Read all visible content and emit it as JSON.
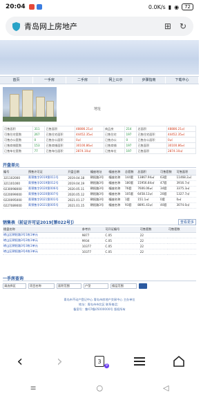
{
  "status_bar": {
    "time": "20:04",
    "network": "0.0K/s",
    "battery": "72",
    "signal_icon": "cellular-signal-icon",
    "wifi_icon": "wifi-icon"
  },
  "address_bar": {
    "page_title": "青岛网上房地产",
    "shield_icon": "shield-icon",
    "bookmark_icon": "bookmark-icon",
    "refresh_icon": "refresh-icon"
  },
  "nav": {
    "items": [
      "首页",
      "一手房",
      "二手房",
      "网上公示",
      "步骤指南",
      "下载中心"
    ]
  },
  "hero": {
    "caption": "地址"
  },
  "stats": {
    "rows": [
      [
        "可售面积",
        "311",
        "已售面积",
        "48886.21㎡",
        "商品房",
        "214",
        "总面积",
        "48886.21㎡"
      ],
      [
        "可售住宅套数",
        "267",
        "已售住宅面积",
        "44452.35㎡",
        "已售住宅",
        "197",
        "已售住宅面积",
        "44452.35㎡"
      ],
      [
        "可售办公套数",
        "0",
        "已售办公面积",
        "0㎡",
        "已售办公",
        "0",
        "已售办公面积",
        "0㎡"
      ],
      [
        "已售商铺套数",
        "153",
        "已售商铺面积",
        "30100.86㎡",
        "已售商铺",
        "197",
        "已售面积",
        "30100.86㎡"
      ],
      [
        "已售车位套数",
        "77",
        "已售车位面积",
        "2874.10㎡",
        "已售车位",
        "197",
        "已售面积",
        "2874.10㎡"
      ]
    ]
  },
  "units_section": {
    "title": "开盘单元",
    "headers": [
      "编号",
      "预售许可证",
      "开盘日期",
      "幢座地址",
      "幢座名称",
      "总套数",
      "总面积",
      "可售套数",
      "可售面积"
    ],
    "rows": [
      [
        "321102000",
        "青预售字2019第011号",
        "2019.04.18",
        "朝阳路3号",
        "幢座名称",
        "144套",
        "13867.94㎡",
        "63套",
        "11468.2㎡"
      ],
      [
        "321101000",
        "青预售字2019第012号",
        "2019.04.19",
        "朝阳路3号",
        "幢座名称",
        "180套",
        "15956.84㎡",
        "47套",
        "3916.7㎡"
      ],
      [
        "0230098000",
        "青预售字2020第006号",
        "2020.05.11",
        "朝阳路3号",
        "幢座名称",
        "76套",
        "7606.06㎡",
        "34套",
        "3375.3㎡"
      ],
      [
        "0220099000",
        "青预售字2020第007号",
        "2020.05.12",
        "朝阳路3号",
        "幢座名称",
        "105套",
        "6458.13㎡",
        "20套",
        "1327.7㎡"
      ],
      [
        "0220095000",
        "青预售字2021第001号",
        "2021.01.17",
        "朝阳路3号",
        "幢座名称",
        "1套",
        "151.1㎡",
        "0套",
        "0㎡"
      ],
      [
        "0227089000",
        "青预售字2021第005号",
        "2021.01.15",
        "朝阳路3号",
        "幢座名称",
        "93套",
        "8891.43㎡",
        "40套",
        "3074.0㎡"
      ]
    ]
  },
  "sales_section": {
    "title": "销售表（前证许可证2019[第022号]）",
    "more_label": "查看更多",
    "headers": [
      "楼盘名称",
      "参考价",
      "可开证编号",
      "可售套数",
      "可售套数"
    ],
    "rows": [
      [
        "崂山区朝阳路3号1栋1单元",
        "9877",
        "C.05",
        "22",
        ""
      ],
      [
        "崂山区朝阳路3号2栋1单元",
        "9934",
        "C.05",
        "22",
        ""
      ],
      [
        "崂山区朝阳路3号3栋1单元",
        "10377",
        "C.05",
        "22",
        ""
      ],
      [
        "崂山区朝阳路3号4栋1单元",
        "10377",
        "C.05",
        "22",
        ""
      ]
    ]
  },
  "query_section": {
    "title": "一手房查询",
    "fields": [
      "请选择区",
      "项目名称",
      "面积范围",
      "户型",
      "楼层范围"
    ],
    "search_icon": "search-icon"
  },
  "footer": {
    "lines": [
      "青岛市不动产登记中心  青岛市房地产交易中心  主办单位",
      "地址：青岛市市北区  联系电话：",
      "备案号：鲁ICP备05000000号  版权所有"
    ]
  },
  "toolbar": {
    "back_icon": "back-arrow-icon",
    "forward_icon": "forward-arrow-icon",
    "tabs_count": "3",
    "tabs_badge": "9",
    "menu_icon": "menu-icon",
    "home_icon": "home-icon"
  },
  "system_nav": {
    "menu_icon": "recent-apps-icon",
    "home_icon": "home-circle-icon",
    "back_icon": "back-triangle-icon"
  },
  "colors": {
    "accent": "#2c5aa0",
    "link": "#2a56b8",
    "green_text": "#1f8f3a",
    "red_text": "#d03a1a",
    "banner": "#c5d4ea"
  }
}
